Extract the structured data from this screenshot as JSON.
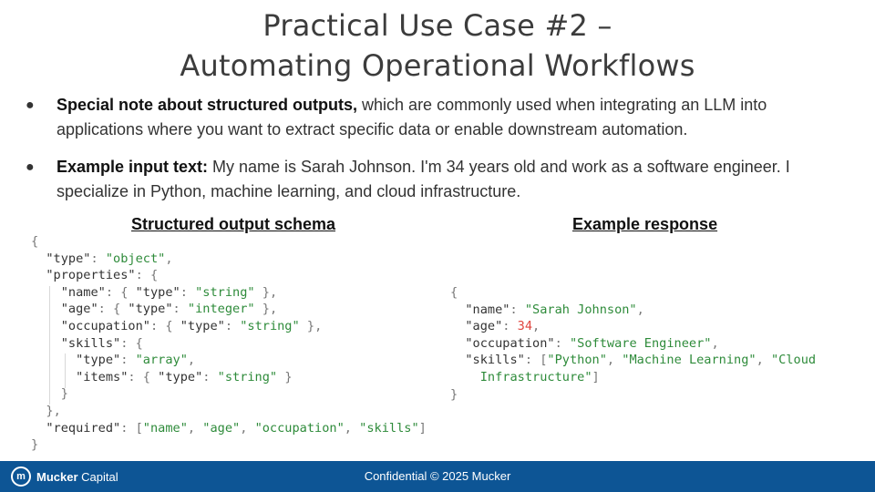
{
  "title": {
    "line1": "Practical Use Case #2 –",
    "line2": "Automating Operational Workflows"
  },
  "bullets": [
    {
      "bold": "Special note about structured outputs,",
      "text": " which are commonly used when integrating an LLM into applications where you want to extract specific data or enable downstream automation."
    },
    {
      "bold": "Example input text:",
      "text": " My name is Sarah Johnson. I'm 34 years old and work as a software engineer. I specialize in Python, machine learning, and cloud infrastructure."
    }
  ],
  "headings": {
    "schema": "Structured output schema",
    "response": "Example response"
  },
  "schema_lines": [
    "{",
    "  \"type\": \"object\",",
    "  \"properties\": {",
    "    \"name\": { \"type\": \"string\" },",
    "    \"age\": { \"type\": \"integer\" },",
    "    \"occupation\": { \"type\": \"string\" },",
    "    \"skills\": {",
    "      \"type\": \"array\",",
    "      \"items\": { \"type\": \"string\" }",
    "    }",
    "  },",
    "  \"required\": [\"name\", \"age\", \"occupation\", \"skills\"]",
    "}"
  ],
  "response_lines": [
    "{",
    "  \"name\": \"Sarah Johnson\",",
    "  \"age\": 34,",
    "  \"occupation\": \"Software Engineer\",",
    "  \"skills\": [\"Python\", \"Machine Learning\", \"Cloud",
    "    Infrastructure\"]",
    "}"
  ],
  "footer": {
    "confidential": "Confidential © 2025 Mucker",
    "logo_bold": "Mucker",
    "logo_rest": " Capital",
    "logo_icon": "mucker-logo-icon"
  },
  "colors": {
    "footer_bg": "#0d5595",
    "string": "#2e8b3a",
    "number": "#e0443e"
  }
}
